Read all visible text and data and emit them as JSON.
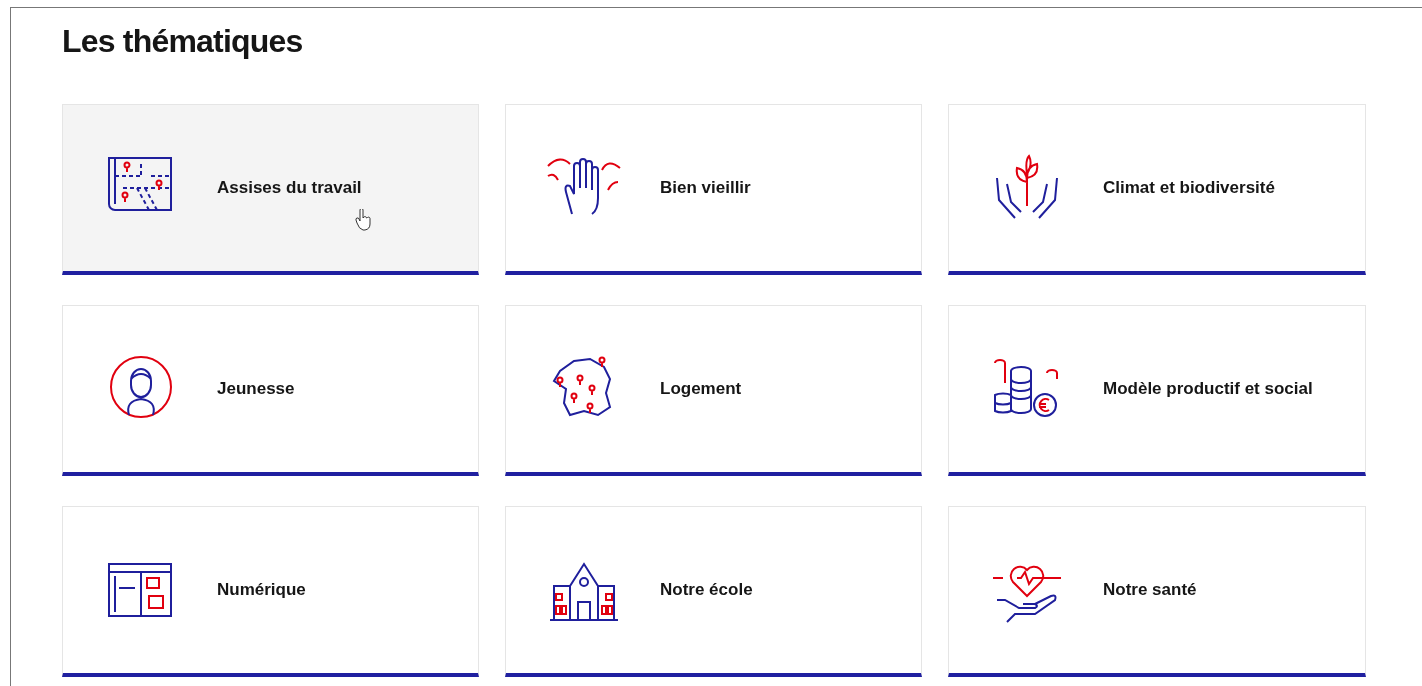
{
  "heading": "Les thématiques",
  "tiles": [
    {
      "label": "Assises du travail",
      "highlighted": true
    },
    {
      "label": "Bien vieillir",
      "highlighted": false
    },
    {
      "label": "Climat et biodiversité",
      "highlighted": false
    },
    {
      "label": "Jeunesse",
      "highlighted": false
    },
    {
      "label": "Logement",
      "highlighted": false
    },
    {
      "label": "Modèle productif et social",
      "highlighted": false
    },
    {
      "label": "Numérique",
      "highlighted": false
    },
    {
      "label": "Notre école",
      "highlighted": false
    },
    {
      "label": "Notre santé",
      "highlighted": false
    }
  ]
}
